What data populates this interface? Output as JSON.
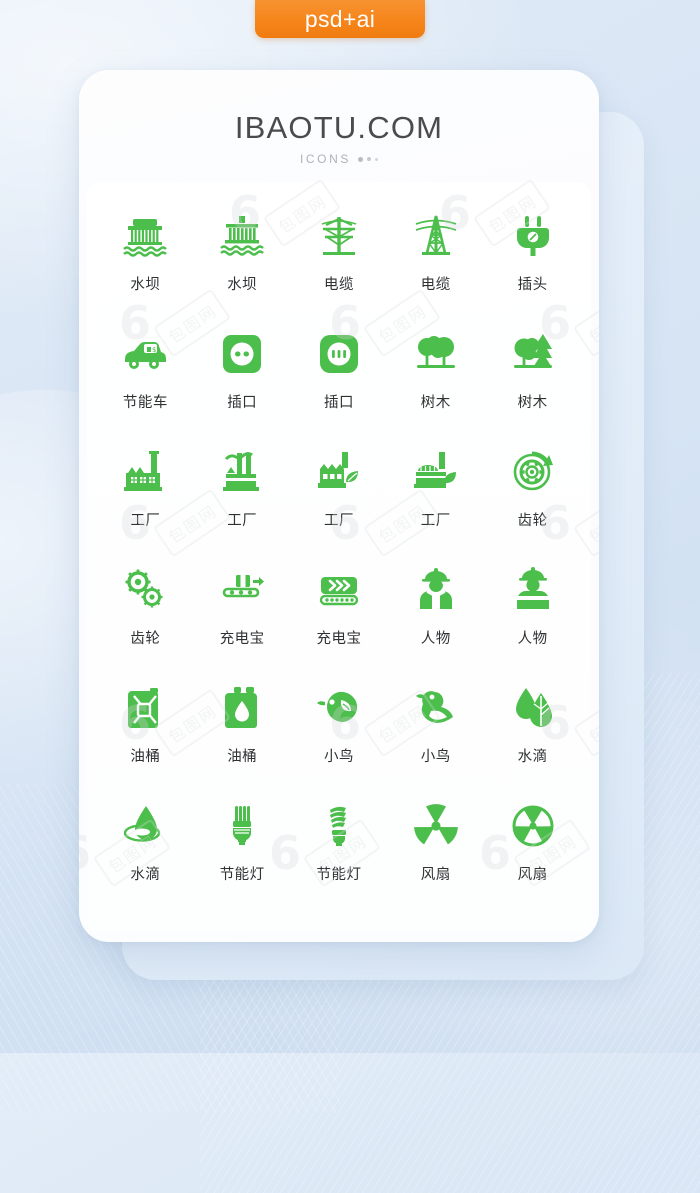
{
  "badge": {
    "label": "psd+ai",
    "color": "#f5851b"
  },
  "brand": {
    "title": "IBAOTU.COM",
    "subtitle": "ICONS"
  },
  "theme": {
    "icon_green": "#4CBE4C",
    "label_color": "#2f3133",
    "background": "#d9e6f4",
    "card": "#fcfdfe"
  },
  "watermark": {
    "mark": "6",
    "text": "包图网"
  },
  "icons": [
    {
      "name": "dam-1",
      "label": "水坝",
      "glyph": "dam"
    },
    {
      "name": "dam-2",
      "label": "水坝",
      "glyph": "dam2"
    },
    {
      "name": "cable-1",
      "label": "电缆",
      "glyph": "pylon"
    },
    {
      "name": "cable-2",
      "label": "电缆",
      "glyph": "tower"
    },
    {
      "name": "plug",
      "label": "插头",
      "glyph": "plug"
    },
    {
      "name": "eco-car",
      "label": "节能车",
      "glyph": "car"
    },
    {
      "name": "socket-1",
      "label": "插口",
      "glyph": "socket2"
    },
    {
      "name": "socket-2",
      "label": "插口",
      "glyph": "socket3"
    },
    {
      "name": "trees-1",
      "label": "树木",
      "glyph": "trees"
    },
    {
      "name": "trees-2",
      "label": "树木",
      "glyph": "trees2"
    },
    {
      "name": "factory-1",
      "label": "工厂",
      "glyph": "factory1"
    },
    {
      "name": "factory-2",
      "label": "工厂",
      "glyph": "factory2"
    },
    {
      "name": "factory-3",
      "label": "工厂",
      "glyph": "factory3"
    },
    {
      "name": "factory-4",
      "label": "工厂",
      "glyph": "factory4"
    },
    {
      "name": "gear-recycle",
      "label": "齿轮",
      "glyph": "gearcycle"
    },
    {
      "name": "gears",
      "label": "齿轮",
      "glyph": "gears"
    },
    {
      "name": "conveyor-1",
      "label": "充电宝",
      "glyph": "conveyor"
    },
    {
      "name": "conveyor-2",
      "label": "充电宝",
      "glyph": "belt"
    },
    {
      "name": "worker-1",
      "label": "人物",
      "glyph": "worker"
    },
    {
      "name": "worker-2",
      "label": "人物",
      "glyph": "worker2"
    },
    {
      "name": "oil-can-1",
      "label": "油桶",
      "glyph": "jerrycan"
    },
    {
      "name": "oil-can-2",
      "label": "油桶",
      "glyph": "jerrycan2"
    },
    {
      "name": "bird-1",
      "label": "小鸟",
      "glyph": "bird"
    },
    {
      "name": "bird-2",
      "label": "小鸟",
      "glyph": "bird2"
    },
    {
      "name": "water-drop-1",
      "label": "水滴",
      "glyph": "drops"
    },
    {
      "name": "water-drop-2",
      "label": "水滴",
      "glyph": "drop-ripple"
    },
    {
      "name": "eco-lamp-1",
      "label": "节能灯",
      "glyph": "cfl"
    },
    {
      "name": "eco-lamp-2",
      "label": "节能灯",
      "glyph": "cfl2"
    },
    {
      "name": "fan-1",
      "label": "风扇",
      "glyph": "radiation"
    },
    {
      "name": "fan-2",
      "label": "风扇",
      "glyph": "radiation2"
    }
  ]
}
